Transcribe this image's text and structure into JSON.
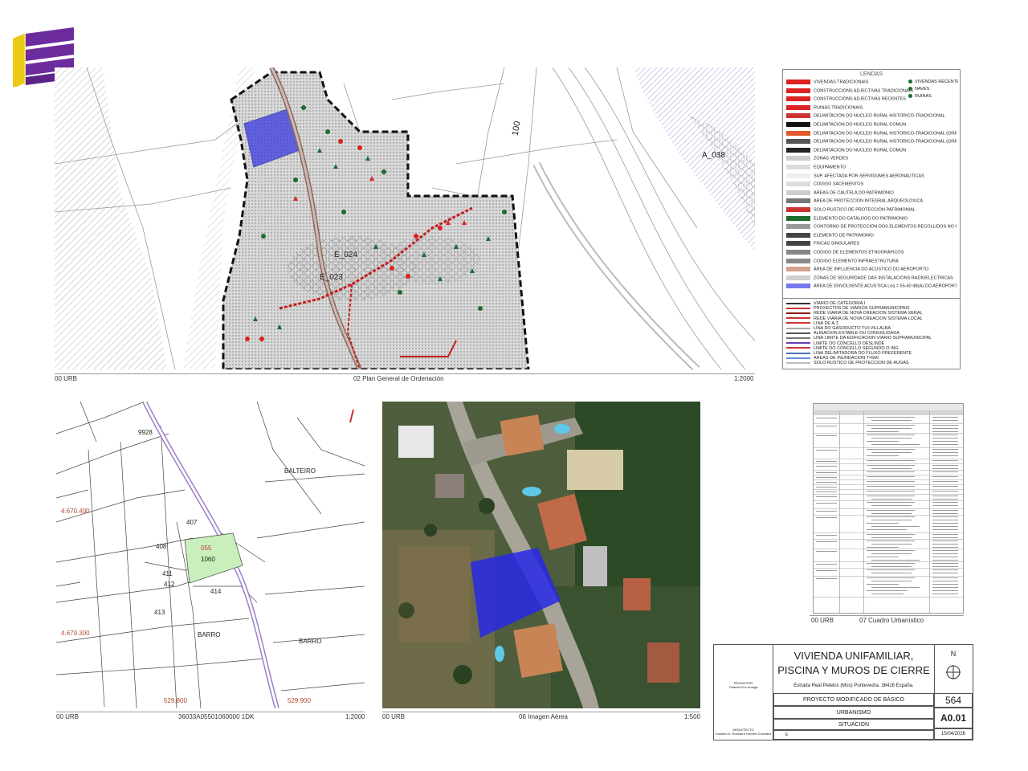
{
  "logo": {
    "name": "logo-icon",
    "colors": [
      "#f2d21a",
      "#6d2c9e",
      "#5a2488"
    ]
  },
  "panel_top": {
    "caption_left": "00 URB",
    "caption_center": "02 Plan General de Ordenación",
    "caption_right": "1:2000",
    "labels": {
      "e024": "E_024",
      "e023": "E_023",
      "a038": "A_038",
      "hundred": "100"
    }
  },
  "legend": {
    "title": "LENDAS",
    "items": [
      "VIVENDAS TRADICIONAIS",
      "CONSTRUCCIÓNS ADJECTIVAS TRADICIONAIS",
      "CONSTRUCCIÓNS ADJECTIVAS RECENTES",
      "RUINAS TRADICIONAIS",
      "DELIMITACIÓN DO NÚCLEO RURAL HISTÓRICO-TRADICIONAL",
      "DELIMITACIÓN DO NÚCLEO RURAL COMÚN",
      "DELIMITACIÓN DO NÚCLEO RURAL HISTÓRICO-TRADICIONAL (GRADO I)",
      "DELIMITACIÓN DO NÚCLEO RURAL HISTÓRICO-TRADICIONAL (GRADO II)",
      "DELIMITACIÓN DO NÚCLEO RURAL COMÚN",
      "ZONAS VERDES",
      "EQUIPAMENTO",
      "SUP. AFECTADA POR SERVIDUMES AERONÁUTICAS",
      "CÓDIGO XACEMENTOS",
      "ÁREAS DE CAUTELA DO PATRIMONIO",
      "ÁREA DE PROTECCIÓN INTEGRAL ARQUEOLÓXICA",
      "SOLO RÚSTICO DE PROTECCIÓN PATRIMONIAL",
      "ELEMENTO DO CATÁLOGO DO PATRIMONIO",
      "CONTORNO DE PROTECCIÓN DOS ELEMENTOS RECOLLIDOS NO CATÁLOGO",
      "ELEMENTO DE PATRIMONIO",
      "FINCAS SINGULARES",
      "CÓDIGO DE ELEMENTOS ETNOGRÁFICOS",
      "CÓDIGO ELEMENTO INFRAESTRUTURA",
      "ÁREA DE INFLUENCIA DO ACÚSTICO DO AEROPORTO",
      "ZONAS DE SEGURIDADE DAS INSTALACIÓNS RADIOELÉCTRICAS",
      "ÁREA DE ENVOLVENTE ACÚSTICA Leq = 55-60 dB(A) DO AEROPORTO."
    ],
    "right_items": [
      "VIVENDAS RECENTES",
      "NAVES",
      "RUINAS"
    ],
    "lower_items": [
      "VIARIO DE CATEGORÍA I",
      "PROXECTOS DE VIARIOS SUPRAMUNICIPAIS",
      "REDE VIARIA DE NOVA CREACIÓN SISTEMA XERAL",
      "REDE VIARIA DE NOVA CREACIÓN SISTEMA LOCAL",
      "LIÑA DE A.T.",
      "LIÑA DO GASODUCTO TUI-VILLALBA",
      "ALIÑACIÓN ESTABLE OU CONSOLIDADA",
      "LIÑA LÍMITE DA EDIFICACIÓN VIARIO SUPRAMUNICIPAL",
      "LÍMITE DO CONCELLO DESLINDE",
      "LÍMITE DO CONCELLO SEGUNDO O ING",
      "LIÑA DELIMITADORA DO FLUXO PREFERENTE",
      "ÁREAS DE INUNDACIÓN T=500",
      "SOLO RÚSTICO DE PROTECCIÓN DE AUGAS"
    ]
  },
  "panel_cadastre": {
    "caption_left": "00 URB",
    "caption_center": "36033A05501060000 1DK",
    "caption_right": "1:2000",
    "labels": {
      "p407": "407",
      "p408": "408",
      "p055": "055",
      "p1060": "1060",
      "p411": "411",
      "p412": "412",
      "p414": "414",
      "p413": "413",
      "barro1": "BARRO",
      "barro2": "BARRO",
      "balteiro": "BALTEIRO",
      "p9928": "9928",
      "coord1": "4.670.400",
      "coord2": "4.670.300",
      "coord3": "529.800",
      "coord4": "529.900"
    }
  },
  "panel_aerial": {
    "caption_left": "00 URB",
    "caption_center": "06 Imagen Aérea",
    "caption_right": "1:500"
  },
  "panel_table": {
    "caption_left": "00 URB",
    "caption_center": "07 Cuadro Urbanístico"
  },
  "title_block": {
    "project_title_1": "VIVIENDA UNIFAMILIAR,",
    "project_title_2": "PISCINA Y MUROS DE CIERRE",
    "address": "Estrada Real Petelos (Mos) Pontevedra. 36416 España.",
    "north": "N",
    "row1": "PROYECTO MODIFICADO DE BÁSICO",
    "row2": "URBANISMO",
    "row3": "SITUACION",
    "number": "564",
    "sheet": "A0.01",
    "date": "15/04/2026",
    "scale_small": "E",
    "promotor_label": "PROMOTOR",
    "promotor_name": "Yolanda Frio Arriaga",
    "arquitecto_label": "ARQUITECTO",
    "arquitecto_name": "Gustavo A. Moscarra Herbert Gonzalez"
  }
}
